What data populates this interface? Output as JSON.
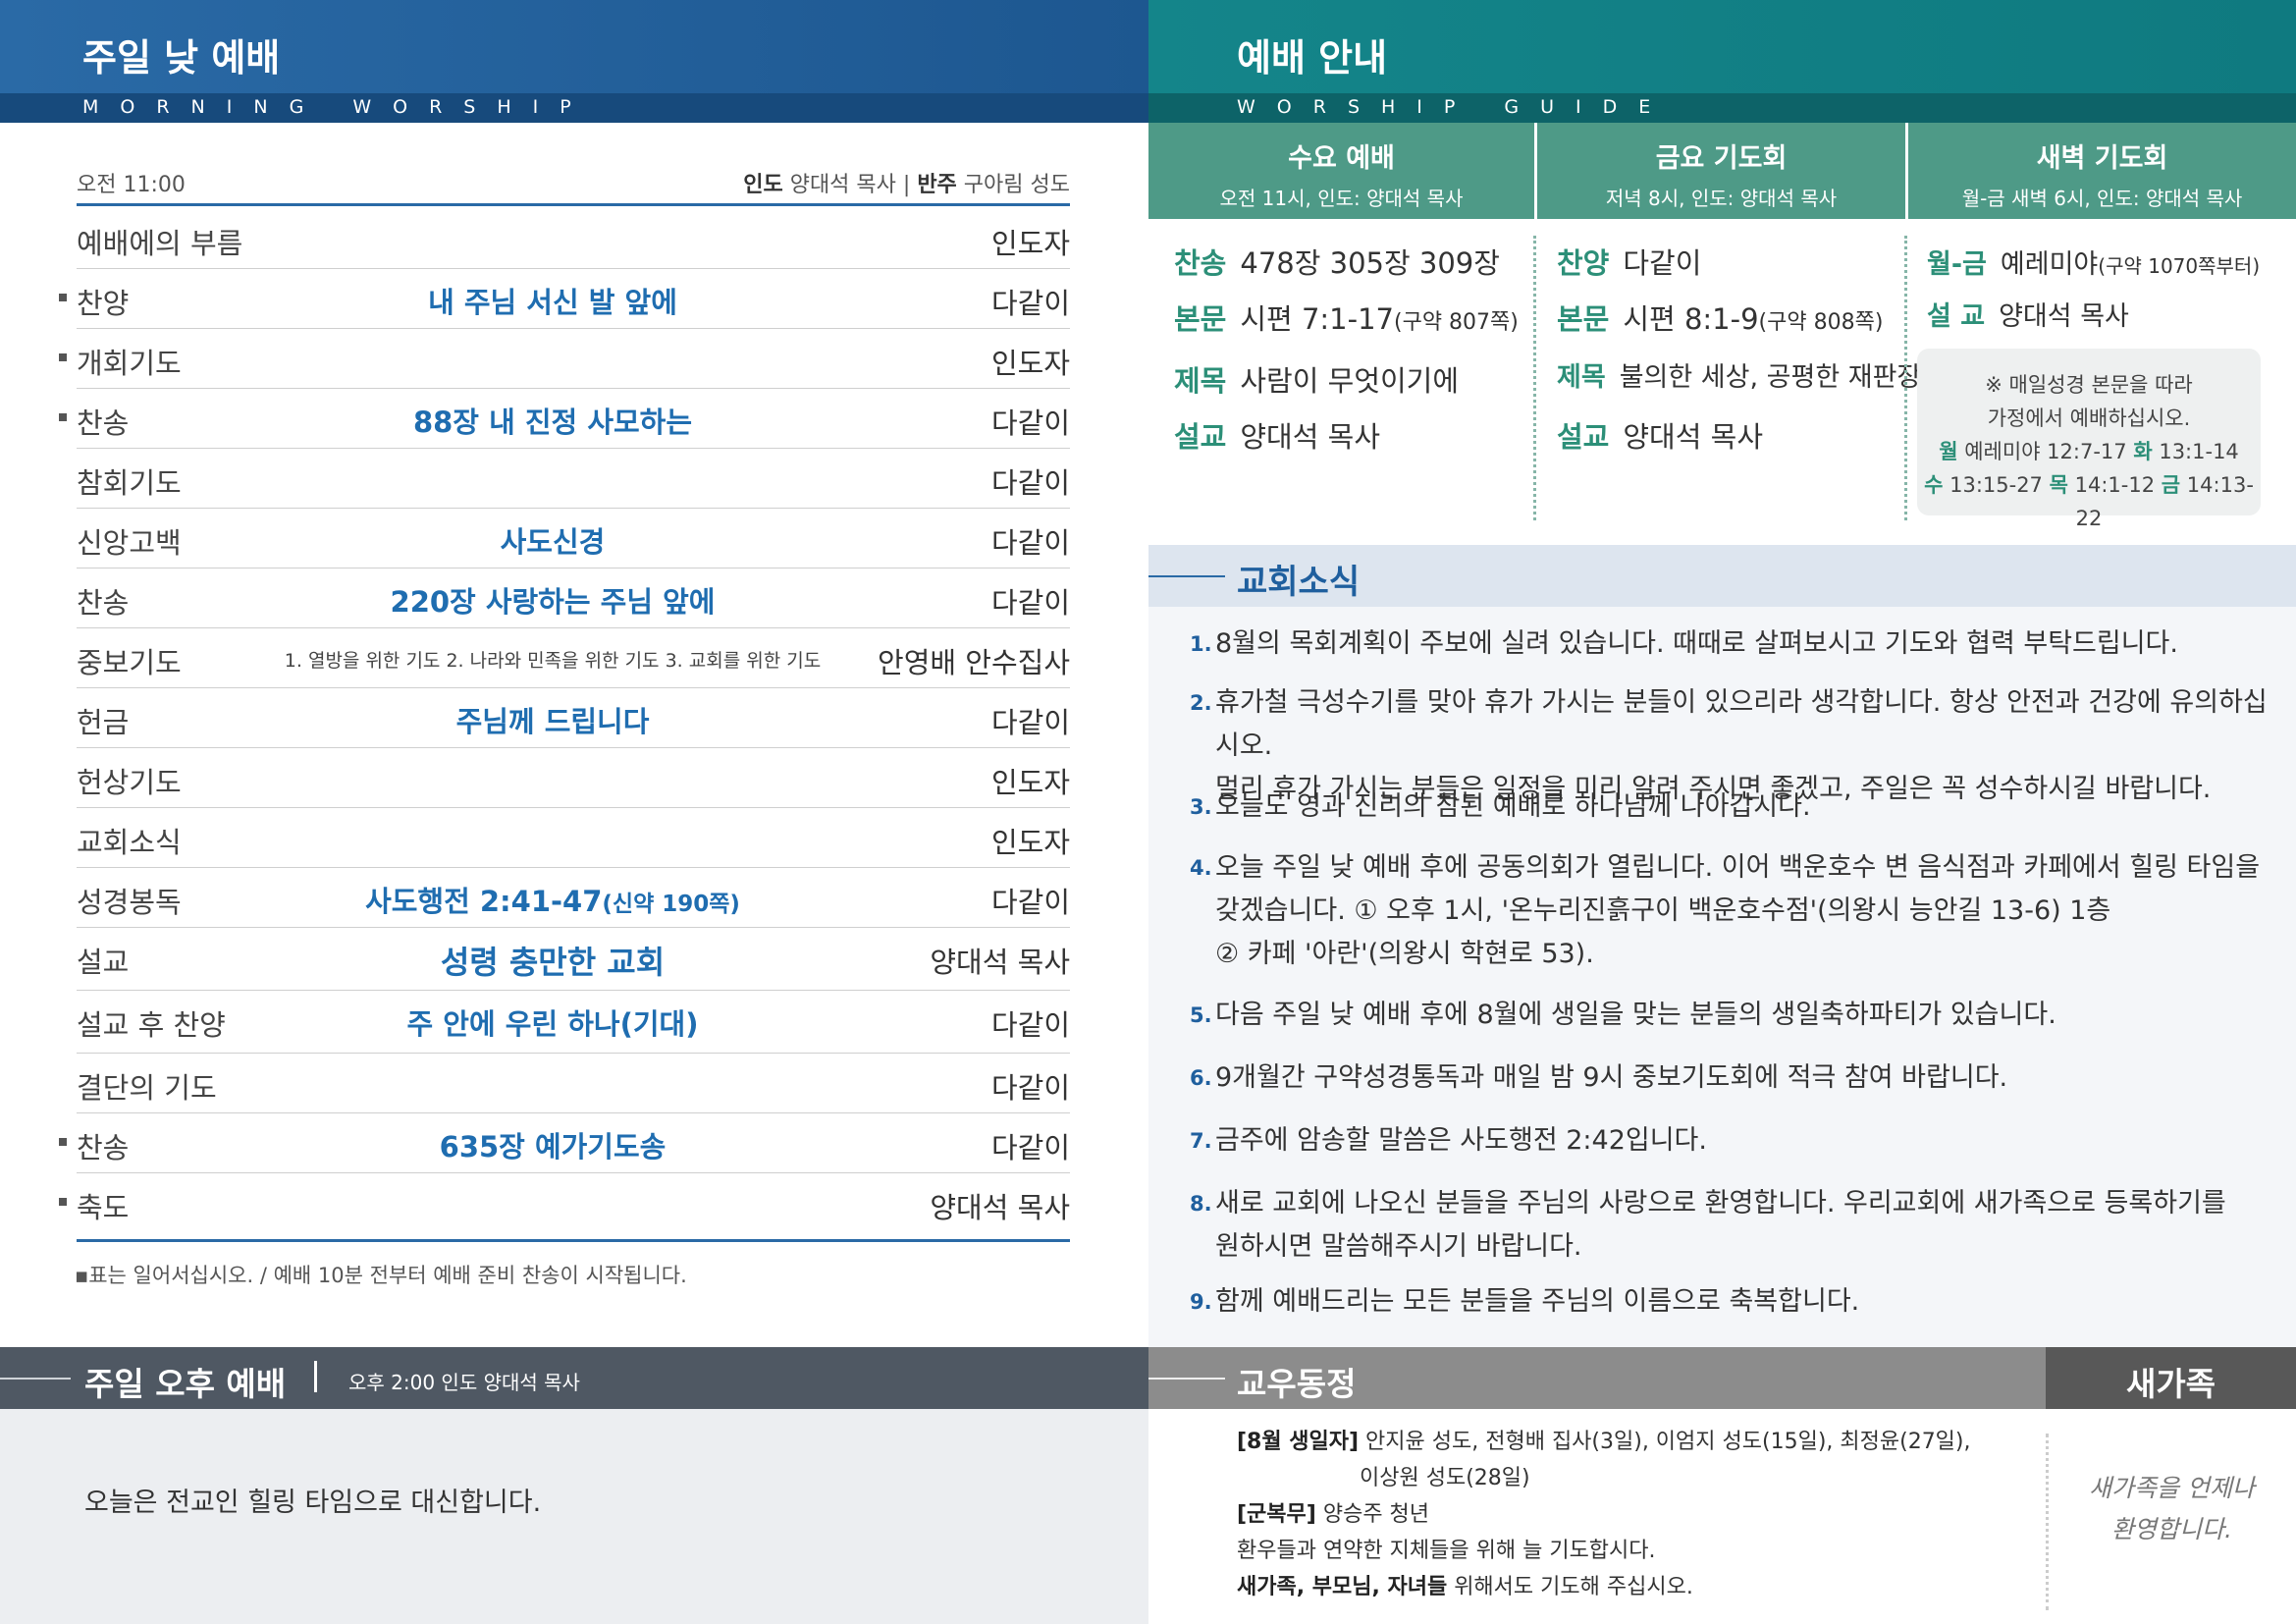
{
  "morning": {
    "title": "주일 낮 예배",
    "subtitle": "MORNING WORSHIP",
    "time": "오전 11:00",
    "lead_label": "인도",
    "lead": "양대석 목사",
    "accomp_label": "반주",
    "accomp": "구아림 성도",
    "rows": [
      {
        "name": "예배에의 부름",
        "title": "",
        "who": "인도자"
      },
      {
        "name": "찬양",
        "title": "내 주님 서신 발 앞에",
        "who": "다같이"
      },
      {
        "name": "개회기도",
        "title": "",
        "who": "인도자"
      },
      {
        "name": "찬송",
        "title": "88장 내 진정 사모하는",
        "who": "다같이"
      },
      {
        "name": "참회기도",
        "title": "",
        "who": "다같이"
      },
      {
        "name": "신앙고백",
        "title": "사도신경",
        "who": "다같이"
      },
      {
        "name": "찬송",
        "title": "220장 사랑하는 주님 앞에",
        "who": "다같이"
      },
      {
        "name": "중보기도",
        "title": "1. 열방을 위한 기도  2. 나라와 민족을 위한 기도  3. 교회를 위한 기도",
        "who": "안영배 안수집사"
      },
      {
        "name": "헌금",
        "title": "주님께 드립니다",
        "who": "다같이"
      },
      {
        "name": "헌상기도",
        "title": "",
        "who": "인도자"
      },
      {
        "name": "교회소식",
        "title": "",
        "who": "인도자"
      },
      {
        "name": "성경봉독",
        "title": "사도행전 2:41-47",
        "title_small": "(신약 190쪽)",
        "who": "다같이"
      },
      {
        "name": "설교",
        "title": "성령 충만한 교회",
        "who": "양대석 목사"
      },
      {
        "name": "설교 후 찬양",
        "title": "주 안에 우린 하나(기대)",
        "who": "다같이"
      },
      {
        "name": "결단의 기도",
        "title": "",
        "who": "다같이"
      },
      {
        "name": "찬송",
        "title": "635장 예가기도송",
        "who": "다같이"
      },
      {
        "name": "축도",
        "title": "",
        "who": "양대석 목사"
      }
    ],
    "note": "표는 일어서십시오. / 예배 10분 전부터 예배 준비 찬송이 시작됩니다."
  },
  "afternoon": {
    "title": "주일 오후 예배",
    "info": "오후 2:00   인도 양대석 목사",
    "body": "오늘은 전교인 힐링 타임으로 대신합니다."
  },
  "guide": {
    "title": "예배 안내",
    "subtitle": "WORSHIP GUIDE",
    "wed": {
      "head": "수요 예배",
      "sub": "오전 11시, 인도: 양대석 목사",
      "hymn_k": "찬송",
      "hymn": "478장 305장 309장",
      "text_k": "본문",
      "text": "시편 7:1-17",
      "text_s": "(구약 807쪽)",
      "title_k": "제목",
      "title": "사람이 무엇이기에",
      "preach_k": "설교",
      "preach": "양대석 목사"
    },
    "fri": {
      "head": "금요 기도회",
      "sub": "저녁 8시, 인도: 양대석 목사",
      "hymn_k": "찬양",
      "hymn": "다같이",
      "text_k": "본문",
      "text": "시편 8:1-9",
      "text_s": "(구약 808쪽)",
      "title_k": "제목",
      "title": "불의한 세상, 공평한 재판장",
      "preach_k": "설교",
      "preach": "양대석 목사"
    },
    "dawn": {
      "head": "새벽 기도회",
      "sub": "월-금 새벽 6시, 인도: 양대석 목사",
      "days_k": "월-금",
      "days": "예레미야",
      "days_s": "(구약 1070쪽부터)",
      "preach_k": "설 교",
      "preach": "양대석 목사",
      "note1": "※ 매일성경 본문을 따라",
      "note2": "가정에서 예배하십시오.",
      "note3a_k": "월",
      "note3a": "예레미야 12:7-17",
      "note3b_k": "화",
      "note3b": "13:1-14",
      "note4a_k": "수",
      "note4a": "13:15-27",
      "note4b_k": "목",
      "note4b": "14:1-12",
      "note4c_k": "금",
      "note4c": "14:13-22"
    }
  },
  "news": {
    "title": "교회소식",
    "items": [
      {
        "n": "1.",
        "lines": [
          "8월의 목회계획이 주보에 실려 있습니다. 때때로 살펴보시고 기도와 협력 부탁드립니다."
        ]
      },
      {
        "n": "2.",
        "lines": [
          "휴가철 극성수기를 맞아 휴가 가시는 분들이 있으리라 생각합니다. 항상 안전과 건강에 유의하십시오.",
          "멀리 휴가 가시는 분들은 일정을 미리 알려 주시면 좋겠고, 주일은 꼭 성수하시길 바랍니다."
        ]
      },
      {
        "n": "3.",
        "lines": [
          "오늘도 영과 진리의 참된 예배로 하나님께 나아갑시다."
        ]
      },
      {
        "n": "4.",
        "lines": [
          "오늘 주일 낮 예배 후에 공동의회가 열립니다. 이어 백운호수 변 음식점과 카페에서 힐링 타임을",
          "갖겠습니다. ① 오후 1시, '온누리진흙구이 백운호수점'(의왕시 능안길 13-6) 1층",
          "② 카페 '아란'(의왕시 학현로 53)."
        ]
      },
      {
        "n": "5.",
        "lines": [
          "다음 주일 낮 예배 후에 8월에 생일을 맞는 분들의 생일축하파티가 있습니다."
        ]
      },
      {
        "n": "6.",
        "lines": [
          "9개월간 구약성경통독과 매일 밤 9시 중보기도회에 적극 참여 바랍니다."
        ]
      },
      {
        "n": "7.",
        "lines": [
          "금주에 암송할 말씀은 사도행전 2:42입니다."
        ]
      },
      {
        "n": "8.",
        "lines": [
          "새로 교회에 나오신 분들을 주님의 사랑으로 환영합니다. 우리교회에 새가족으로 등록하기를",
          "원하시면 말씀해주시기 바랍니다."
        ]
      },
      {
        "n": "9.",
        "lines": [
          "함께 예배드리는 모든 분들을 주님의 이름으로 축복합니다."
        ]
      }
    ]
  },
  "friends": {
    "title": "교우동정",
    "bday_k": "[8월 생일자]",
    "bday1": "안지윤 성도, 전형배 집사(3일), 이엄지 성도(15일), 최정윤(27일),",
    "bday2": "이상원 성도(28일)",
    "mil_k": "[군복무]",
    "mil": "양승주 청년",
    "line3": "환우들과 연약한 지체들을 위해 늘 기도합시다.",
    "line4_k": "새가족, 부모님, 자녀들",
    "line4": " 위해서도 기도해 주십시오."
  },
  "newfamily": {
    "title": "새가족",
    "line1": "새가족을 언제나",
    "line2": "환영합니다."
  },
  "colors": {
    "blue": "#1f6db0",
    "teal": "#0f7a80",
    "green": "#4e9a87",
    "gray": "#4f5863"
  }
}
